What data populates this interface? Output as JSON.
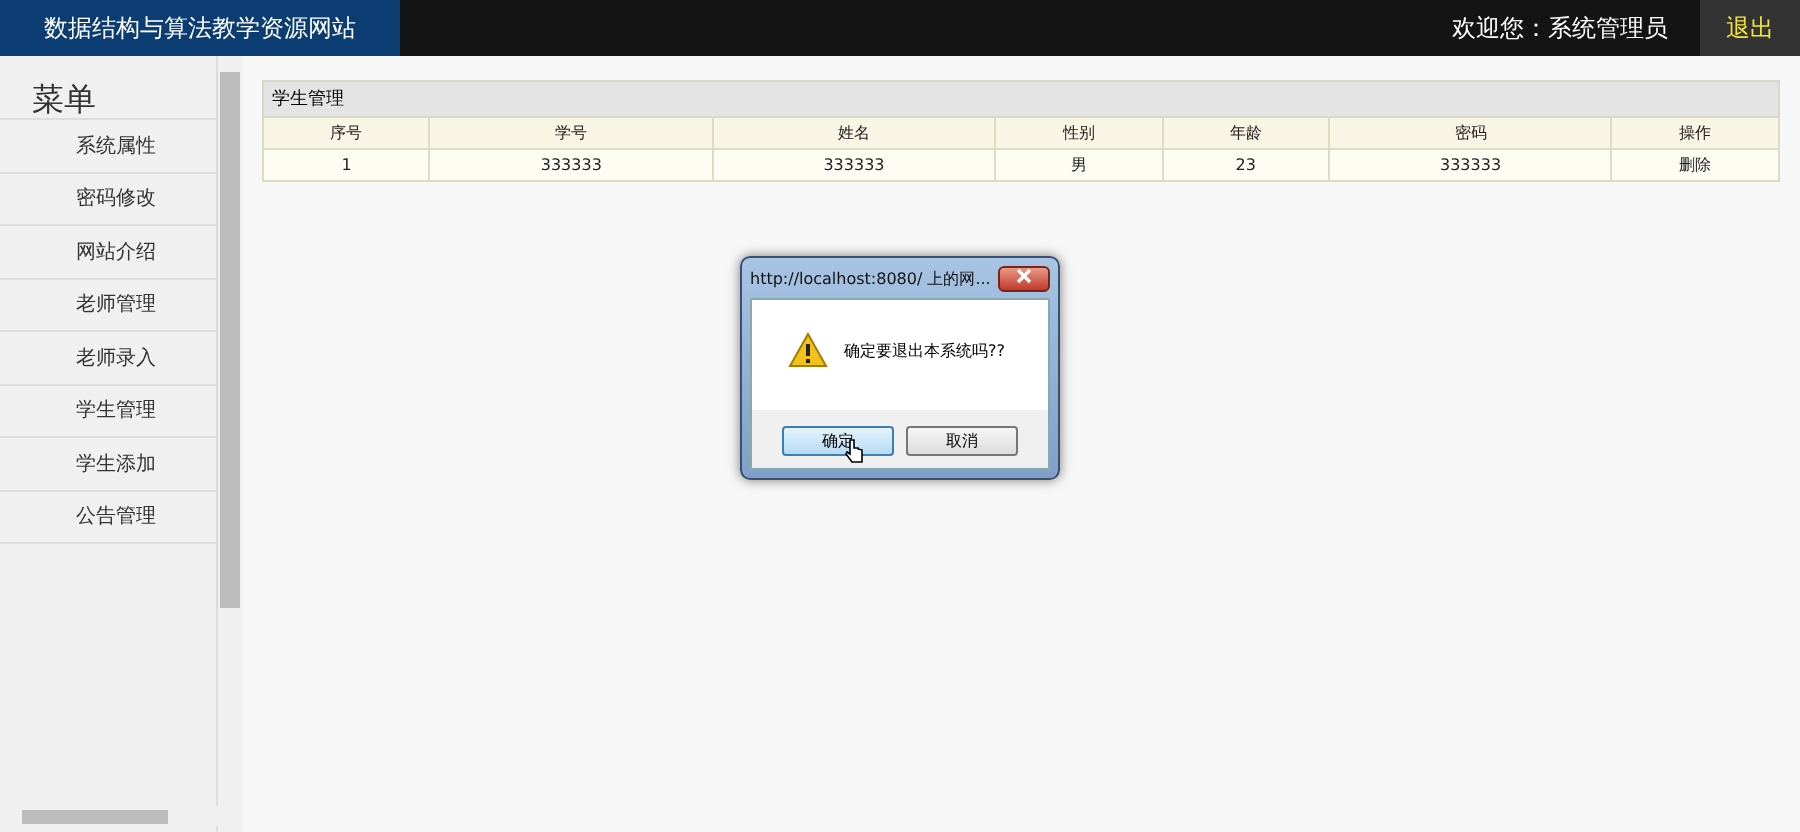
{
  "header": {
    "site_title": "数据结构与算法教学资源网站",
    "welcome": "欢迎您：系统管理员",
    "logout": "退出"
  },
  "sidebar": {
    "title": "菜单",
    "items": [
      {
        "label": "系统属性"
      },
      {
        "label": "密码修改"
      },
      {
        "label": "网站介绍"
      },
      {
        "label": "老师管理"
      },
      {
        "label": "老师录入"
      },
      {
        "label": "学生管理"
      },
      {
        "label": "学生添加"
      },
      {
        "label": "公告管理"
      }
    ]
  },
  "panel": {
    "title": "学生管理",
    "columns": [
      "序号",
      "学号",
      "姓名",
      "性别",
      "年龄",
      "密码",
      "操作"
    ],
    "rows": [
      {
        "cells": [
          "1",
          "333333",
          "333333",
          "男",
          "23",
          "333333"
        ],
        "action": "删除"
      }
    ]
  },
  "dialog": {
    "title": "http://localhost:8080/ 上的网...",
    "message": "确定要退出本系统吗??",
    "buttons": [
      {
        "label": "确定",
        "focused": true
      },
      {
        "label": "取消",
        "focused": false
      }
    ]
  }
}
